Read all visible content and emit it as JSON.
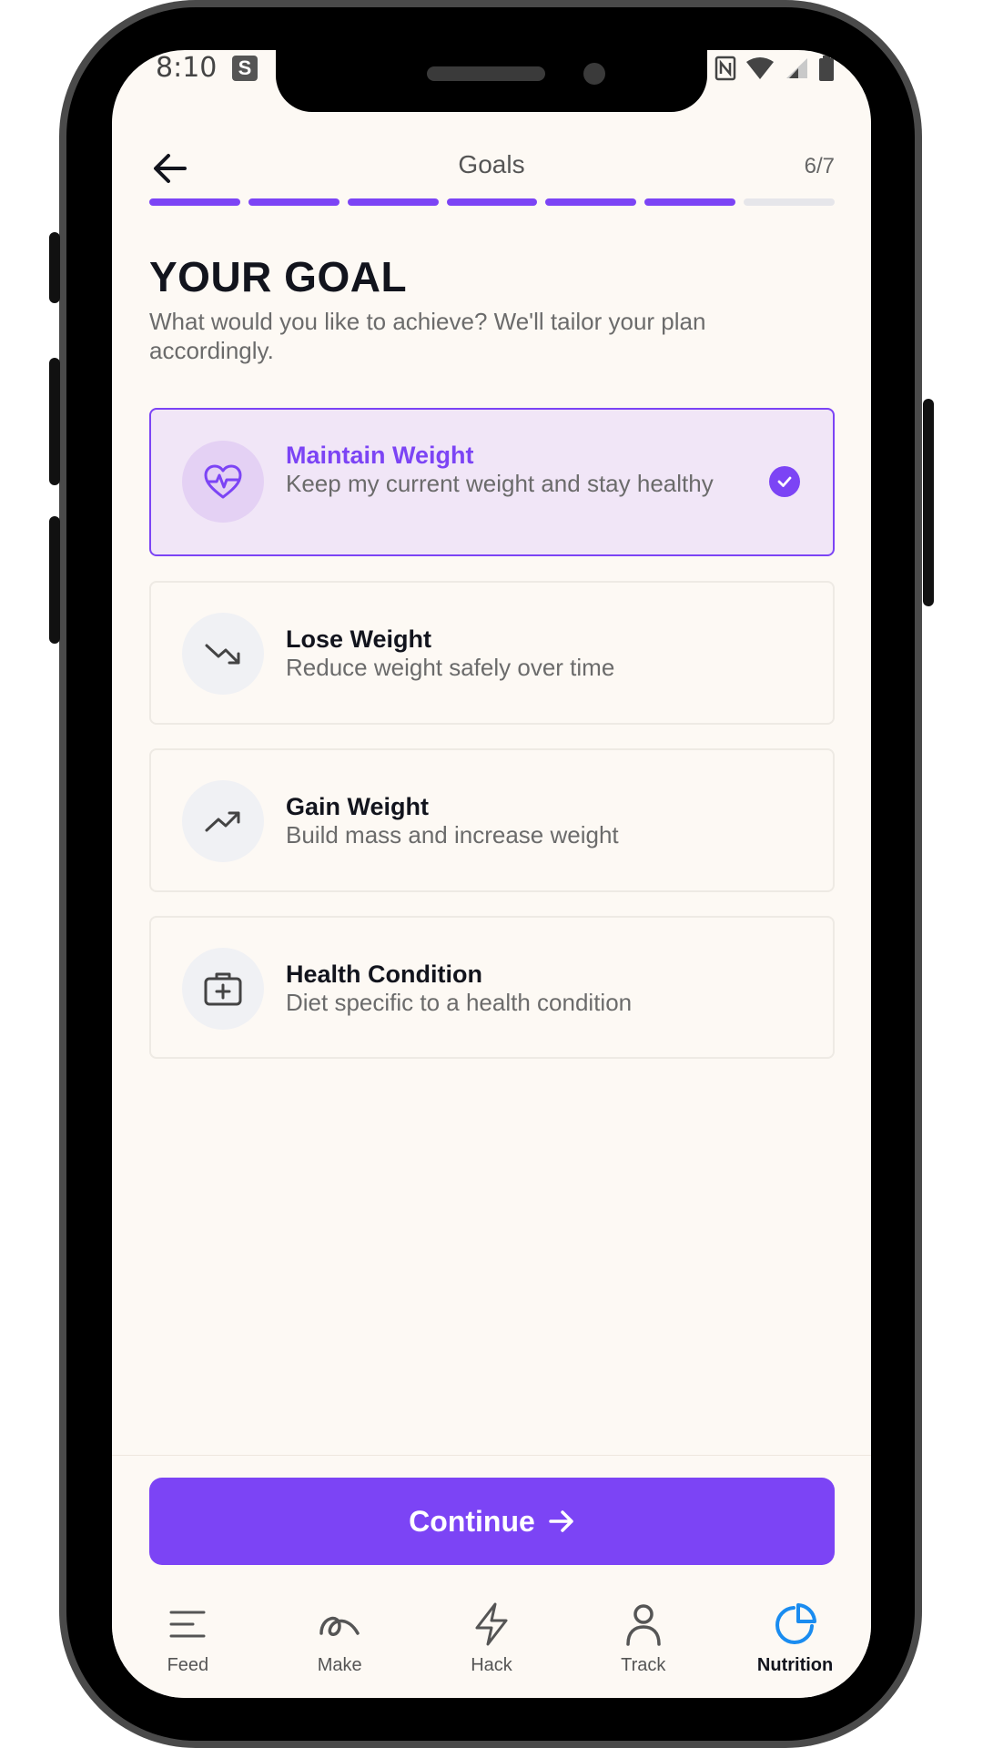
{
  "status_bar": {
    "time": "8:10",
    "app_badge": "S"
  },
  "header": {
    "title": "Goals",
    "step": "6/7"
  },
  "progress": {
    "completed_steps": 6,
    "total_steps": 7
  },
  "goal": {
    "title": "YOUR GOAL",
    "subtitle": "What would you like to achieve? We'll tailor your plan accordingly."
  },
  "options": [
    {
      "title": "Maintain Weight",
      "desc": "Keep my current weight and stay healthy",
      "icon": "heart-pulse-icon",
      "selected": true
    },
    {
      "title": "Lose Weight",
      "desc": "Reduce weight safely over time",
      "icon": "trend-down-icon",
      "selected": false
    },
    {
      "title": "Gain Weight",
      "desc": "Build mass and increase weight",
      "icon": "trend-up-icon",
      "selected": false
    },
    {
      "title": "Health Condition",
      "desc": "Diet specific to a health condition",
      "icon": "medical-kit-icon",
      "selected": false
    }
  ],
  "continue_label": "Continue",
  "tabs": [
    {
      "label": "Feed",
      "icon": "feed-icon"
    },
    {
      "label": "Make",
      "icon": "make-icon"
    },
    {
      "label": "Hack",
      "icon": "bolt-icon"
    },
    {
      "label": "Track",
      "icon": "person-icon"
    },
    {
      "label": "Nutrition",
      "icon": "pie-chart-icon",
      "active": true
    }
  ],
  "colors": {
    "accent": "#7c44f5",
    "background": "#fdf9f4",
    "selected_bg": "#f1e6f7",
    "text": "#12141d"
  }
}
